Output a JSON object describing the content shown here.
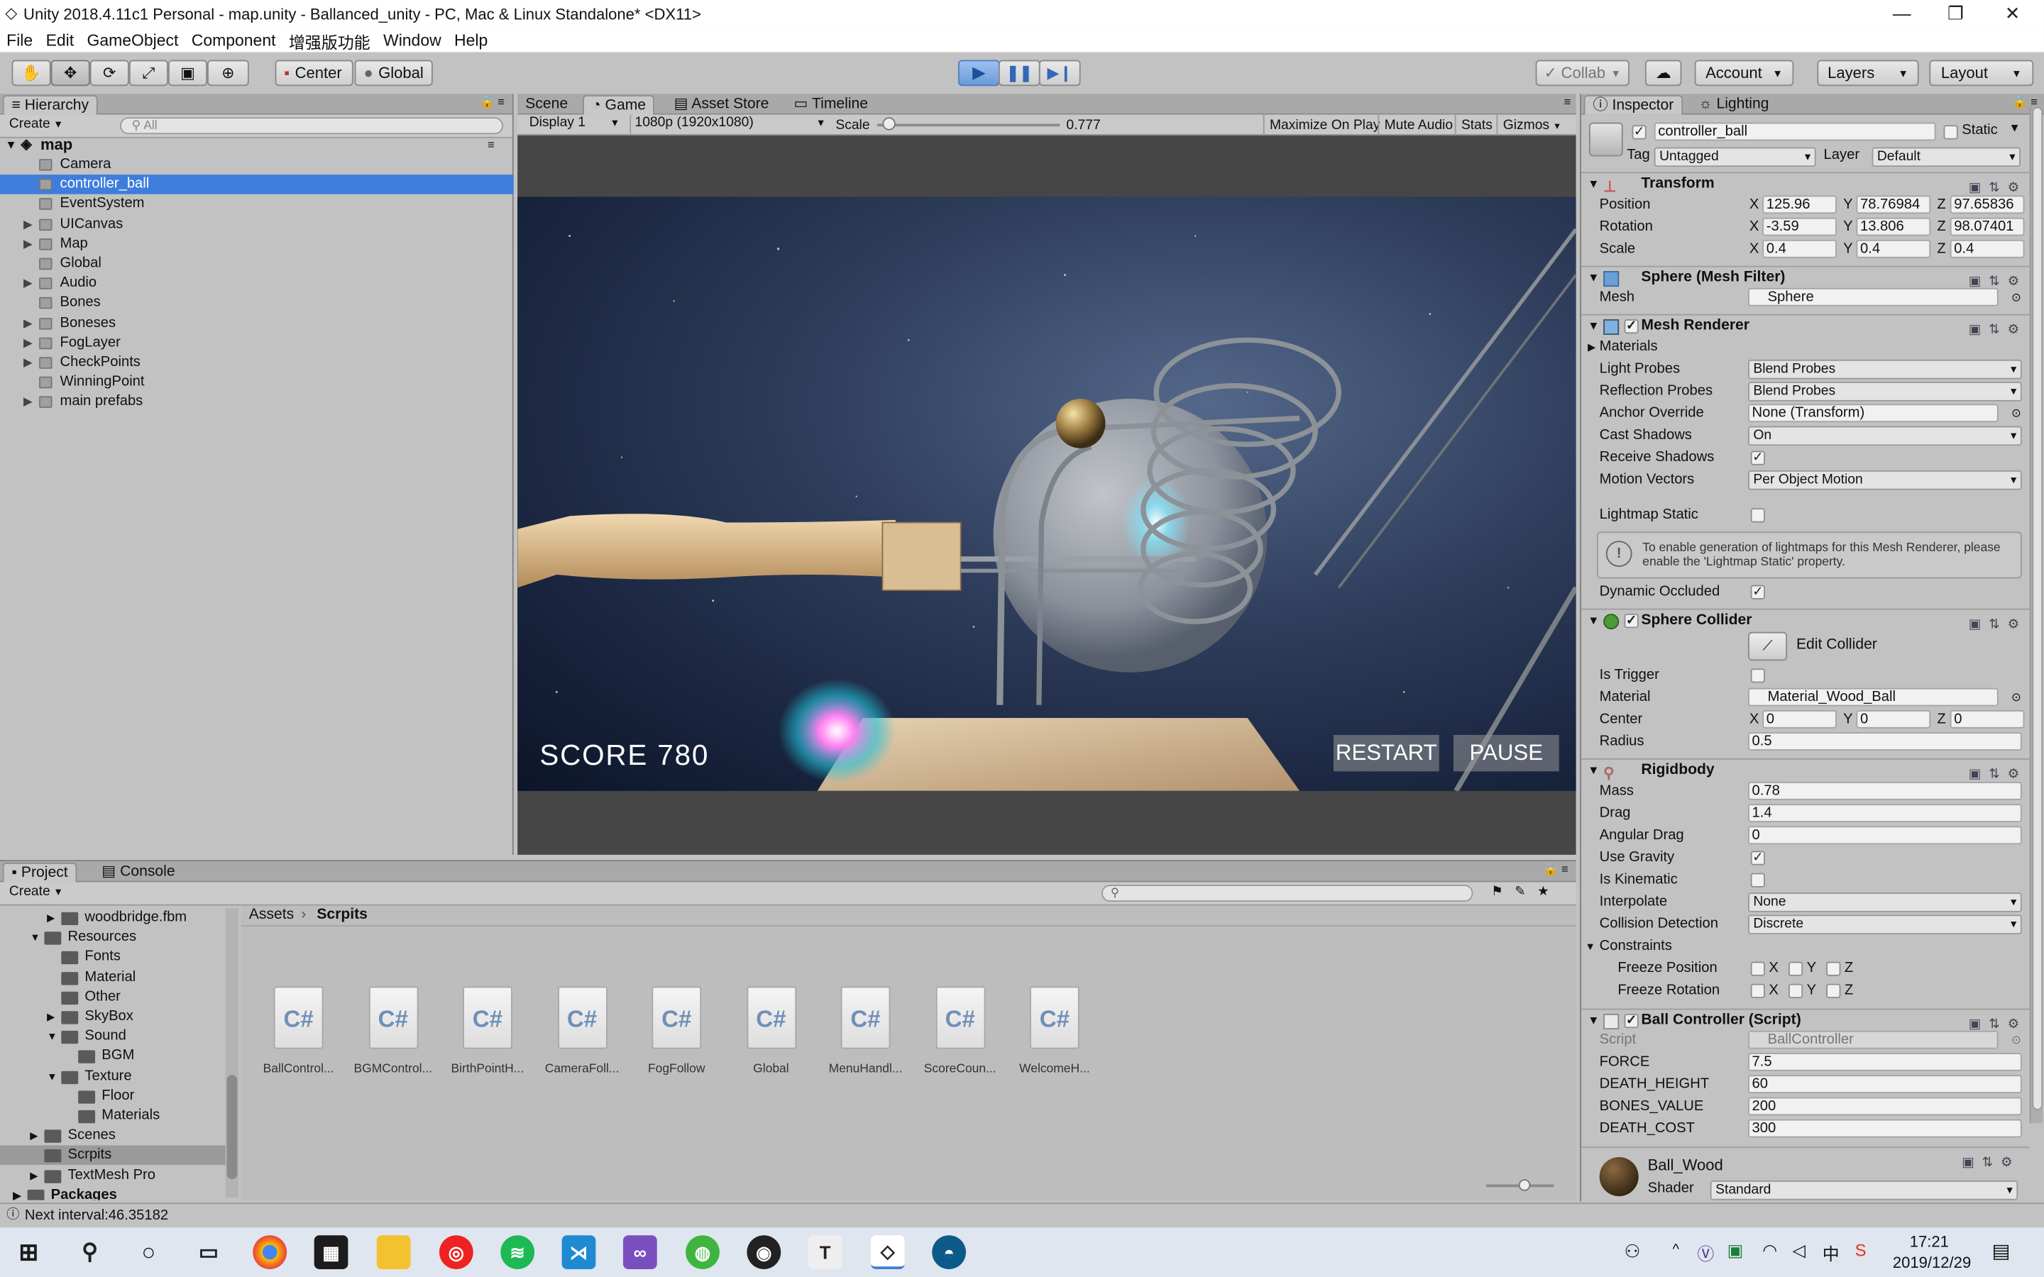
{
  "window": {
    "title": "Unity 2018.4.11c1 Personal - map.unity - Ballanced_unity - PC, Mac & Linux Standalone* <DX11>"
  },
  "menu": [
    "File",
    "Edit",
    "GameObject",
    "Component",
    "增强版功能",
    "Window",
    "Help"
  ],
  "toolbar": {
    "center": "Center",
    "global": "Global",
    "collab": "Collab",
    "account": "Account",
    "layers": "Layers",
    "layout": "Layout"
  },
  "hierarchy": {
    "tab": "Hierarchy",
    "create": "Create",
    "search_placeholder": "All",
    "scene": "map",
    "items": [
      {
        "label": "Camera",
        "expand": false
      },
      {
        "label": "controller_ball",
        "expand": false,
        "selected": true
      },
      {
        "label": "EventSystem",
        "expand": false
      },
      {
        "label": "UICanvas",
        "expand": true
      },
      {
        "label": "Map",
        "expand": true
      },
      {
        "label": "Global",
        "expand": false
      },
      {
        "label": "Audio",
        "expand": true
      },
      {
        "label": "Bones",
        "expand": false
      },
      {
        "label": "Boneses",
        "expand": true
      },
      {
        "label": "FogLayer",
        "expand": true
      },
      {
        "label": "CheckPoints",
        "expand": true
      },
      {
        "label": "WinningPoint",
        "expand": false
      },
      {
        "label": "main prefabs",
        "expand": true
      }
    ]
  },
  "gameview": {
    "tabs": [
      "Scene",
      "Game",
      "Asset Store",
      "Timeline"
    ],
    "display": "Display 1",
    "resolution": "1080p (1920x1080)",
    "scale_label": "Scale",
    "scale_value": "0.777",
    "scale_slider": 0.03,
    "toggles": [
      "Maximize On Play",
      "Mute Audio",
      "Stats",
      "Gizmos"
    ],
    "score": "SCORE  780",
    "restart": "RESTART",
    "pause": "PAUSE"
  },
  "inspector": {
    "tabs": [
      "Inspector",
      "Lighting"
    ],
    "object_name": "controller_ball",
    "static": "Static",
    "tag_label": "Tag",
    "tag": "Untagged",
    "layer_label": "Layer",
    "layer": "Default",
    "transform": {
      "title": "Transform",
      "position_label": "Position",
      "rotation_label": "Rotation",
      "scale_label": "Scale",
      "position": [
        "125.96",
        "78.76984",
        "97.65836"
      ],
      "rotation": [
        "-3.59",
        "13.806",
        "98.07401"
      ],
      "scale": [
        "0.4",
        "0.4",
        "0.4"
      ]
    },
    "mesh_filter": {
      "title": "Sphere (Mesh Filter)",
      "mesh_label": "Mesh",
      "mesh": "Sphere"
    },
    "mesh_renderer": {
      "title": "Mesh Renderer",
      "materials": "Materials",
      "light_probes_label": "Light Probes",
      "light_probes": "Blend Probes",
      "reflection_probes_label": "Reflection Probes",
      "reflection_probes": "Blend Probes",
      "anchor_override_label": "Anchor Override",
      "anchor_override": "None (Transform)",
      "cast_shadows_label": "Cast Shadows",
      "cast_shadows": "On",
      "receive_shadows_label": "Receive Shadows",
      "motion_vectors_label": "Motion Vectors",
      "motion_vectors": "Per Object Motion",
      "lightmap_static_label": "Lightmap Static",
      "info": "To enable generation of lightmaps for this Mesh Renderer, please enable the 'Lightmap Static' property.",
      "dynamic_occluded_label": "Dynamic Occluded"
    },
    "sphere_collider": {
      "title": "Sphere Collider",
      "edit_collider": "Edit Collider",
      "is_trigger_label": "Is Trigger",
      "material_label": "Material",
      "material": "Material_Wood_Ball",
      "center_label": "Center",
      "center": [
        "0",
        "0",
        "0"
      ],
      "radius_label": "Radius",
      "radius": "0.5"
    },
    "rigidbody": {
      "title": "Rigidbody",
      "mass_label": "Mass",
      "mass": "0.78",
      "drag_label": "Drag",
      "drag": "1.4",
      "angular_drag_label": "Angular Drag",
      "angular_drag": "0",
      "use_gravity_label": "Use Gravity",
      "is_kinematic_label": "Is Kinematic",
      "interpolate_label": "Interpolate",
      "interpolate": "None",
      "collision_label": "Collision Detection",
      "collision": "Discrete",
      "constraints": "Constraints",
      "freeze_position": "Freeze Position",
      "freeze_rotation": "Freeze Rotation"
    },
    "ball_controller": {
      "title": "Ball Controller (Script)",
      "script_label": "Script",
      "script": "BallController",
      "force_label": "FORCE",
      "force": "7.5",
      "death_height_label": "DEATH_HEIGHT",
      "death_height": "60",
      "bones_value_label": "BONES_VALUE",
      "bones_value": "200",
      "death_cost_label": "DEATH_COST",
      "death_cost": "300"
    },
    "material": {
      "name": "Ball_Wood",
      "shader_label": "Shader",
      "shader": "Standard"
    }
  },
  "project": {
    "tabs": [
      "Project",
      "Console"
    ],
    "create": "Create",
    "tree": [
      {
        "label": "woodbridge.fbm",
        "depth": 2,
        "arrow": "▶"
      },
      {
        "label": "Resources",
        "depth": 1,
        "arrow": "▼"
      },
      {
        "label": "Fonts",
        "depth": 2,
        "arrow": ""
      },
      {
        "label": "Material",
        "depth": 2,
        "arrow": ""
      },
      {
        "label": "Other",
        "depth": 2,
        "arrow": ""
      },
      {
        "label": "SkyBox",
        "depth": 2,
        "arrow": "▶"
      },
      {
        "label": "Sound",
        "depth": 2,
        "arrow": "▼"
      },
      {
        "label": "BGM",
        "depth": 3,
        "arrow": ""
      },
      {
        "label": "Texture",
        "depth": 2,
        "arrow": "▼"
      },
      {
        "label": "Floor",
        "depth": 3,
        "arrow": ""
      },
      {
        "label": "Materials",
        "depth": 3,
        "arrow": ""
      },
      {
        "label": "Scenes",
        "depth": 1,
        "arrow": "▶"
      },
      {
        "label": "Scrpits",
        "depth": 1,
        "arrow": "",
        "selected": true
      },
      {
        "label": "TextMesh Pro",
        "depth": 1,
        "arrow": "▶"
      },
      {
        "label": "Packages",
        "depth": 0,
        "arrow": "▶",
        "bold": true
      }
    ],
    "breadcrumb": [
      "Assets",
      "Scrpits"
    ],
    "assets": [
      "BallControl...",
      "BGMControl...",
      "BirthPointH...",
      "CameraFoll...",
      "FogFollow",
      "Global",
      "MenuHandl...",
      "ScoreCoun...",
      "WelcomeH..."
    ],
    "cs_label": "C#"
  },
  "status": {
    "text": "Next interval:46.35182"
  },
  "taskbar": {
    "time": "17:21",
    "date": "2019/12/29"
  }
}
